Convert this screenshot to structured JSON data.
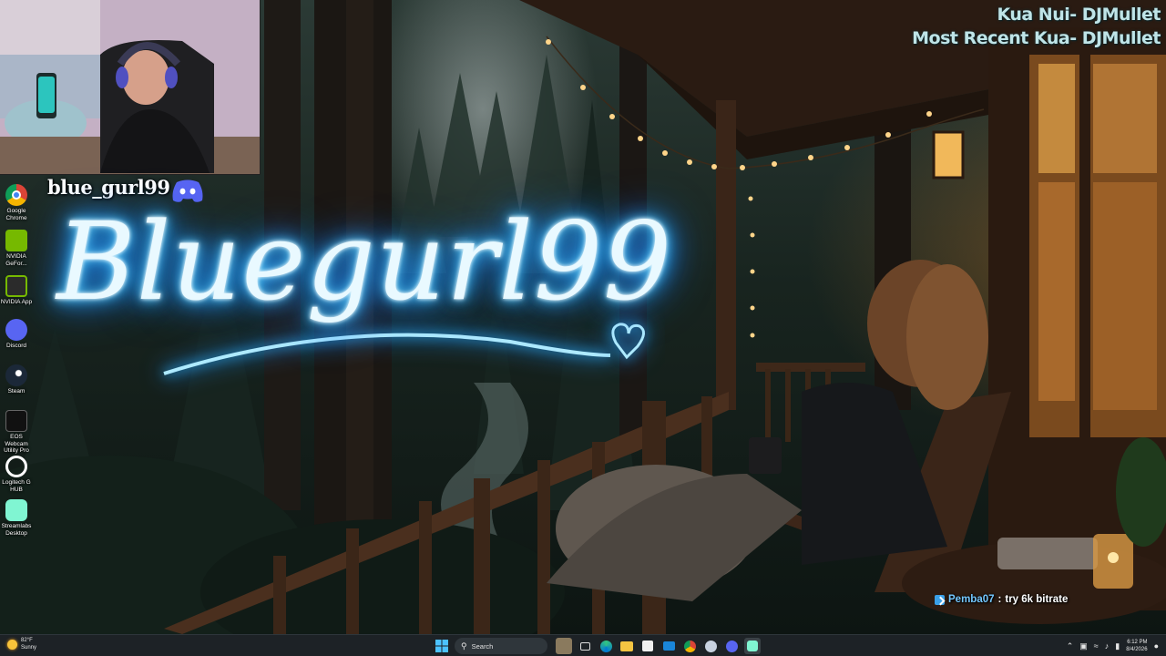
{
  "stream_overlay": {
    "discord_handle": "blue_gurl99",
    "neon_sign_text": "Bluegurl99",
    "alerts": {
      "line1": "Kua Nui- DJMullet",
      "line2": "Most Recent Kua- DJMullet"
    },
    "chat_message": {
      "user": "Pemba07",
      "separator": " : ",
      "text": "try 6k bitrate"
    }
  },
  "desktop_icons": [
    {
      "label": "Google Chrome",
      "icon": "chrome-icon"
    },
    {
      "label": "NVIDIA GeFor...",
      "icon": "nvidia-geforce-icon"
    },
    {
      "label": "NVIDIA App",
      "icon": "nvidia-app-icon"
    },
    {
      "label": "Discord",
      "icon": "discord-icon"
    },
    {
      "label": "Steam",
      "icon": "steam-icon"
    },
    {
      "label": "EOS Webcam Utility Pro",
      "icon": "eos-webcam-icon"
    },
    {
      "label": "Logitech G HUB",
      "icon": "logitech-ghub-icon"
    },
    {
      "label": "Streamlabs Desktop",
      "icon": "streamlabs-icon"
    }
  ],
  "taskbar": {
    "weather_temp": "82°F",
    "weather_desc": "Sunny",
    "search_placeholder": "Search",
    "clock_time": "6:12 PM",
    "clock_date": "8/4/2026",
    "pinned": [
      "start-icon",
      "widget-icon",
      "task-view-icon",
      "edge-icon",
      "file-explorer-icon",
      "store-icon",
      "mail-icon",
      "chrome-icon",
      "steam-icon",
      "discord-icon",
      "streamlabs-icon"
    ]
  }
}
